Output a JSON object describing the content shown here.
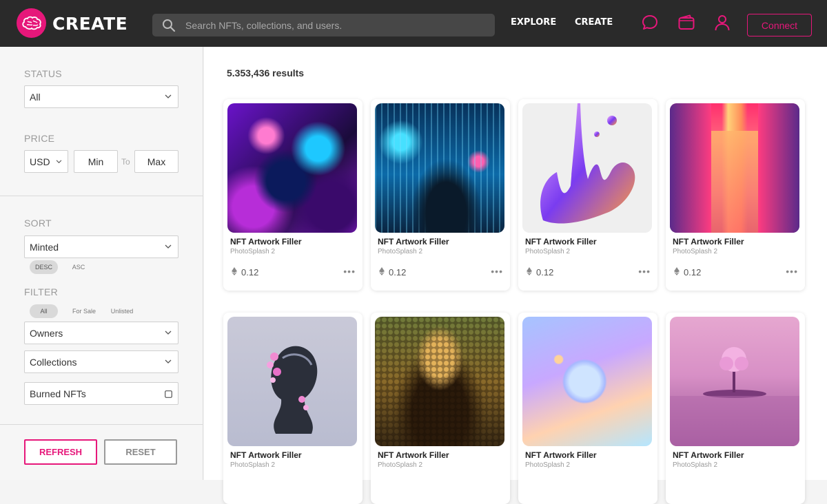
{
  "header": {
    "brand": "CREATE",
    "search_placeholder": "Search NFTs, collections, and users.",
    "nav": [
      "EXPLORE",
      "CREATE"
    ],
    "connect_label": "Connect",
    "icons": [
      "chat-icon",
      "wallet-icon",
      "user-icon"
    ]
  },
  "colors": {
    "accent": "#e6177a",
    "header_bg": "#2a2a2a"
  },
  "sidebar": {
    "status": {
      "label": "STATUS",
      "value": "All"
    },
    "price": {
      "label": "PRICE",
      "currency": "USD",
      "min": "Min",
      "to": "To",
      "max": "Max"
    },
    "sort": {
      "label": "SORT",
      "value": "Minted",
      "orders": [
        "DESC",
        "ASC"
      ],
      "active_order": "DESC"
    },
    "filter": {
      "label": "FILTER",
      "tabs": [
        "All",
        "For Sale",
        "Unlisted"
      ],
      "active_tab": "All",
      "owners": "Owners",
      "collections": "Collections",
      "burned": "Burned NFTs"
    },
    "refresh_label": "REFRESH",
    "reset_label": "RESET"
  },
  "main": {
    "results": "5.353,436 results",
    "cards": [
      {
        "title": "NFT Artwork Filler",
        "sub": "PhotoSplash 2",
        "price": "0.12",
        "more": "•••"
      },
      {
        "title": "NFT Artwork Filler",
        "sub": "PhotoSplash 2",
        "price": "0.12",
        "more": "•••"
      },
      {
        "title": "NFT Artwork Filler",
        "sub": "PhotoSplash 2",
        "price": "0.12",
        "more": "•••"
      },
      {
        "title": "NFT Artwork Filler",
        "sub": "PhotoSplash 2",
        "price": "0.12",
        "more": "•••"
      },
      {
        "title": "NFT Artwork Filler",
        "sub": "PhotoSplash 2",
        "price": "",
        "more": ""
      },
      {
        "title": "NFT Artwork Filler",
        "sub": "PhotoSplash 2",
        "price": "",
        "more": ""
      },
      {
        "title": "NFT Artwork Filler",
        "sub": "PhotoSplash 2",
        "price": "",
        "more": ""
      },
      {
        "title": "NFT Artwork Filler",
        "sub": "PhotoSplash 2",
        "price": "",
        "more": ""
      }
    ]
  }
}
